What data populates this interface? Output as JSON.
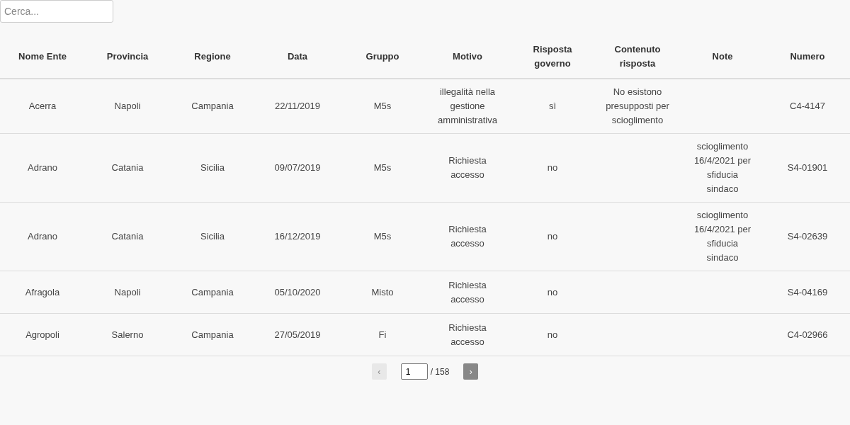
{
  "search": {
    "placeholder": "Cerca..."
  },
  "table": {
    "columns": [
      "Nome Ente",
      "Provincia",
      "Regione",
      "Data",
      "Gruppo",
      "Motivo",
      "Risposta governo",
      "Contenuto risposta",
      "Note",
      "Numero"
    ],
    "rows": [
      [
        "Acerra",
        "Napoli",
        "Campania",
        "22/11/2019",
        "M5s",
        "illegalità nella gestione amministrativa",
        "sì",
        "No esistono presupposti per scioglimento",
        "",
        "C4-4147"
      ],
      [
        "Adrano",
        "Catania",
        "Sicilia",
        "09/07/2019",
        "M5s",
        "Richiesta accesso",
        "no",
        "",
        "scioglimento 16/4/2021 per sfiducia sindaco",
        "S4-01901"
      ],
      [
        "Adrano",
        "Catania",
        "Sicilia",
        "16/12/2019",
        "M5s",
        "Richiesta accesso",
        "no",
        "",
        "scioglimento 16/4/2021 per sfiducia sindaco",
        "S4-02639"
      ],
      [
        "Afragola",
        "Napoli",
        "Campania",
        "05/10/2020",
        "Misto",
        "Richiesta accesso",
        "no",
        "",
        "",
        "S4-04169"
      ],
      [
        "Agropoli",
        "Salerno",
        "Campania",
        "27/05/2019",
        "Fi",
        "Richiesta accesso",
        "no",
        "",
        "",
        "C4-02966"
      ]
    ]
  },
  "pagination": {
    "previous": {
      "label": "‹",
      "disabled": true
    },
    "page": "1",
    "total": "/ 158",
    "next": {
      "label": "›",
      "disabled": false
    }
  }
}
